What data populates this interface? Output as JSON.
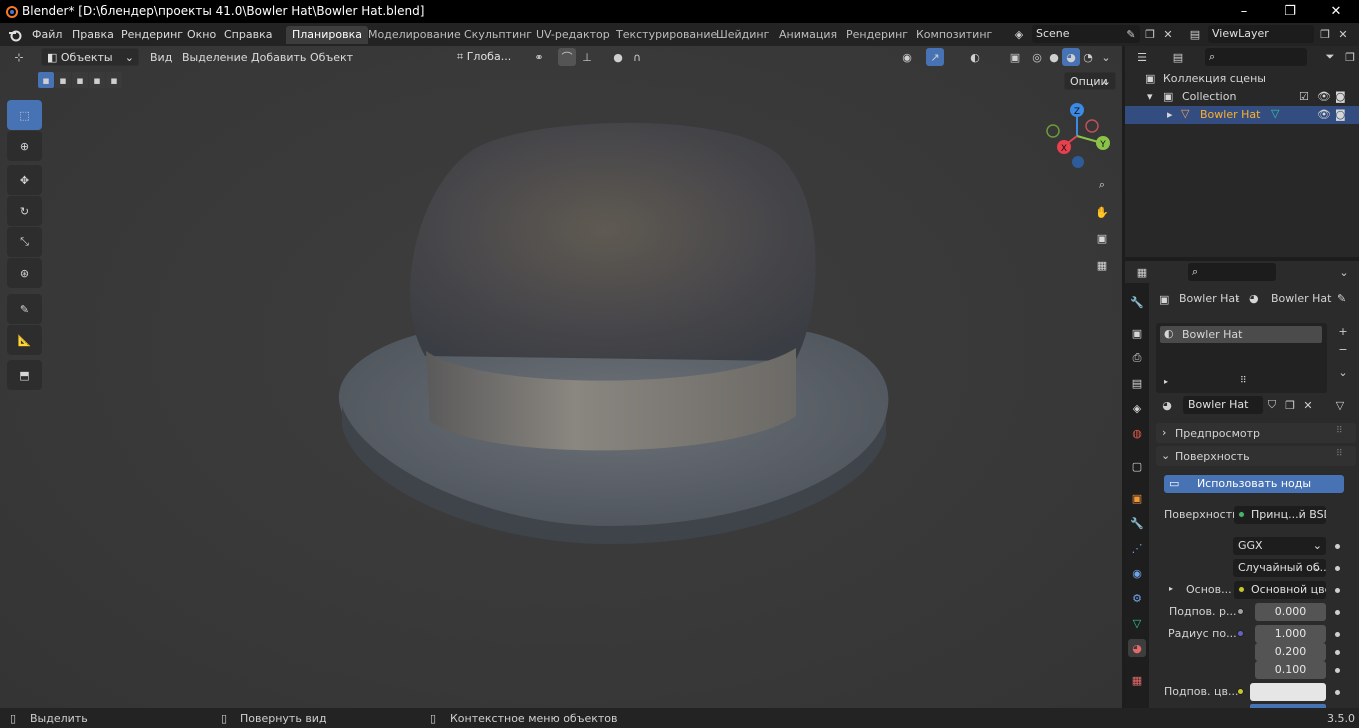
{
  "window": {
    "title": "Blender* [D:\\блендер\\проекты 41.0\\Bowler Hat\\Bowler Hat.blend]",
    "controls": [
      "–",
      "❐",
      "✕"
    ]
  },
  "menu": {
    "items": [
      "Файл",
      "Правка",
      "Рендеринг",
      "Окно",
      "Справка"
    ],
    "workspaces": [
      "Планировка",
      "Моделирование",
      "Скульптинг",
      "UV-редактор",
      "Текстурирование",
      "Шейдинг",
      "Анимация",
      "Рендеринг",
      "Композитинг"
    ],
    "active_workspace": "Планировка",
    "scene": "Scene",
    "view_layer": "ViewLayer"
  },
  "viewport": {
    "mode": "Объекты",
    "menus": [
      "Вид",
      "Выделение",
      "Добавить",
      "Объект"
    ],
    "transform_orientation": "Глоба...",
    "options_label": "Опции",
    "gizmo_axes": {
      "z": "Z",
      "y": "Y",
      "x": "X"
    },
    "accent": "#4772b3"
  },
  "outliner": {
    "scene_collection": "Коллекция сцены",
    "collection": "Collection",
    "object": "Bowler Hat"
  },
  "properties": {
    "breadcrumb_object": "Bowler Hat",
    "breadcrumb_material": "Bowler Hat",
    "material_slot": "Bowler Hat",
    "material_name": "Bowler Hat",
    "preview_label": "Предпросмотр",
    "surface_panel": "Поверхность",
    "use_nodes_button": "Использовать ноды",
    "surface_label": "Поверхность",
    "surface_value": "Принц...й BSDF",
    "distribution": "GGX",
    "subsurface_method": "Случайный об...",
    "base_label": "Основ...",
    "base_value": "Основной цвет",
    "subsurface_label": "Подпов. р...",
    "subsurface_value": "0.000",
    "radius_label": "Радиус по...",
    "radius_values": [
      "1.000",
      "0.200",
      "0.100"
    ],
    "subsurface_color_label": "Подпов. цв..."
  },
  "status": {
    "select": "Выделить",
    "rotate": "Повернуть вид",
    "context": "Контекстное меню объектов",
    "version": "3.5.0"
  }
}
